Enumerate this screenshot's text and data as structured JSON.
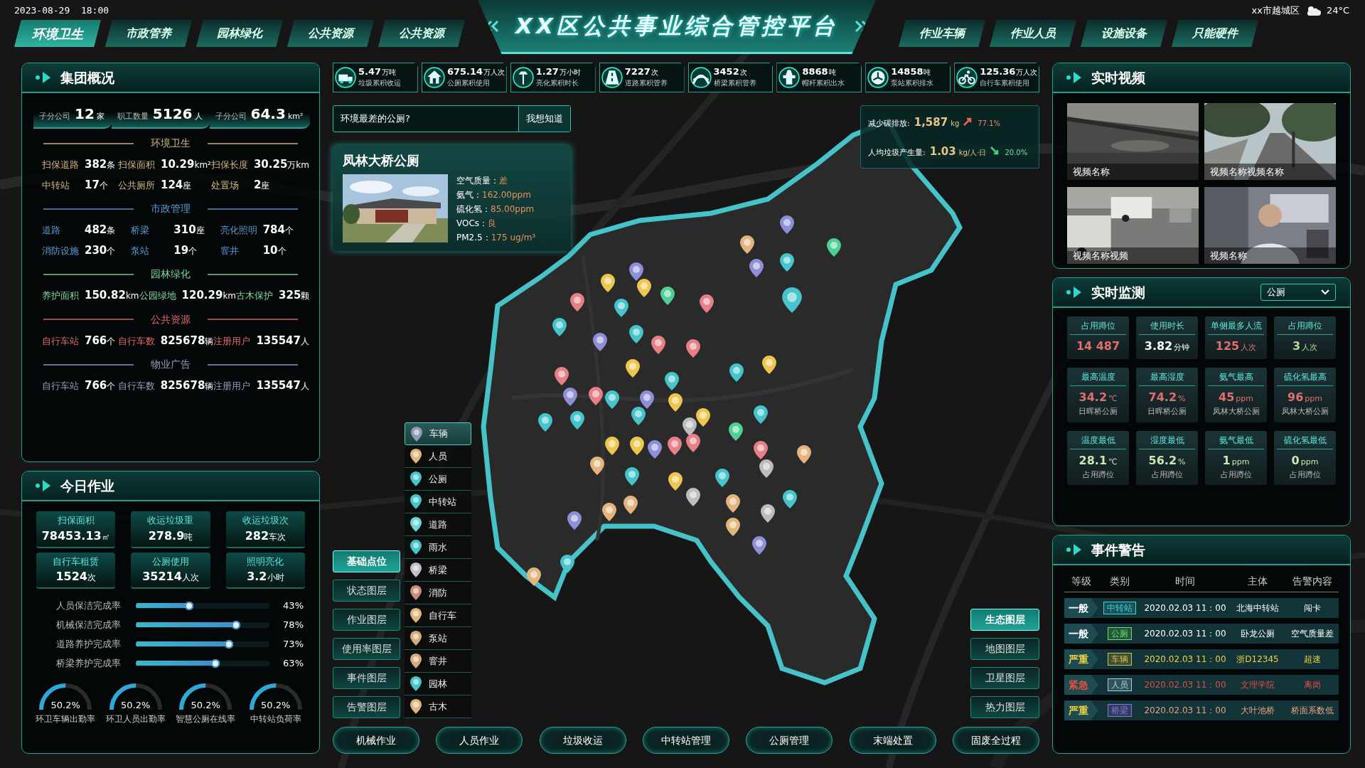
{
  "header": {
    "datetime": "2023-08-29  18:00",
    "title": "XX区公共事业综合管控平台",
    "location": "xx市越城区",
    "temperature": "24°C",
    "left_tabs": [
      {
        "label": "环境卫生",
        "selected": true
      },
      {
        "label": "市政管养",
        "selected": false
      },
      {
        "label": "园林绿化",
        "selected": false
      },
      {
        "label": "公共资源",
        "selected": false
      },
      {
        "label": "公共资源",
        "selected": false
      }
    ],
    "right_tabs": [
      {
        "label": "作业车辆",
        "selected": false
      },
      {
        "label": "作业人员",
        "selected": false
      },
      {
        "label": "设施设备",
        "selected": false
      },
      {
        "label": "只能硬件",
        "selected": false
      }
    ]
  },
  "group_overview": {
    "title": "集团概况",
    "summary": [
      {
        "label": "子分公司",
        "value": "12",
        "unit": "家"
      },
      {
        "label": "职工数量",
        "value": "5126",
        "unit": "人"
      },
      {
        "label": "子分公司",
        "value": "64.3",
        "unit": "km²"
      }
    ],
    "sections": [
      {
        "title": "环境卫生",
        "color": "#d4b483",
        "items": [
          {
            "label": "扫保道路",
            "value": "382",
            "unit": "条"
          },
          {
            "label": "扫保面积",
            "value": "10.29",
            "unit": "km²"
          },
          {
            "label": "扫保长度",
            "value": "30.25",
            "unit": "万km"
          },
          {
            "label": "中转站",
            "value": "17",
            "unit": "个"
          },
          {
            "label": "公共厕所",
            "value": "124",
            "unit": "座"
          },
          {
            "label": "处置场",
            "value": "2",
            "unit": "座"
          }
        ]
      },
      {
        "title": "市政管理",
        "color": "#5b9bd5",
        "items": [
          {
            "label": "道路",
            "value": "482",
            "unit": "条"
          },
          {
            "label": "桥梁",
            "value": "310",
            "unit": "座"
          },
          {
            "label": "亮化照明",
            "value": "784",
            "unit": "个"
          },
          {
            "label": "消防设施",
            "value": "230",
            "unit": "个"
          },
          {
            "label": "泵站",
            "value": "19",
            "unit": "个"
          },
          {
            "label": "窨井",
            "value": "10",
            "unit": "个"
          }
        ]
      },
      {
        "title": "园林绿化",
        "color": "#7ed6a0",
        "items": [
          {
            "label": "养护面积",
            "value": "150.82",
            "unit": "km"
          },
          {
            "label": "公园绿地",
            "value": "120.29",
            "unit": "km"
          },
          {
            "label": "古木保护",
            "value": "325",
            "unit": "颗"
          }
        ]
      },
      {
        "title": "公共资源",
        "color": "#e46a6a",
        "items": [
          {
            "label": "自行车站",
            "value": "766",
            "unit": "个"
          },
          {
            "label": "自行车数",
            "value": "825678",
            "unit": "辆"
          },
          {
            "label": "注册用户",
            "value": "135547",
            "unit": "人"
          }
        ]
      },
      {
        "title": "物业广告",
        "color": "#9b9bc0",
        "items": [
          {
            "label": "自行车站",
            "value": "766",
            "unit": "个"
          },
          {
            "label": "自行车数",
            "value": "825678",
            "unit": "辆"
          },
          {
            "label": "注册用户",
            "value": "135547",
            "unit": "人"
          }
        ]
      }
    ]
  },
  "today_work": {
    "title": "今日作业",
    "tiles": [
      {
        "label": "扫保面积",
        "value": "78453.13",
        "unit": "㎡"
      },
      {
        "label": "收运垃圾重",
        "value": "278.9",
        "unit": "吨"
      },
      {
        "label": "收运垃圾次",
        "value": "282",
        "unit": "车次"
      },
      {
        "label": "自行车租赁",
        "value": "1524",
        "unit": "次"
      },
      {
        "label": "公厕使用",
        "value": "35214",
        "unit": "人次"
      },
      {
        "label": "照明亮化",
        "value": "3.2",
        "unit": "小时"
      }
    ],
    "progress": [
      {
        "label": "人员保洁完成率",
        "level": 0.43,
        "reading": "43%"
      },
      {
        "label": "机械保洁完成率",
        "level": 0.78,
        "reading": "78%"
      },
      {
        "label": "道路养护完成率",
        "level": 0.73,
        "reading": "73%"
      },
      {
        "label": "桥梁养护完成率",
        "level": 0.63,
        "reading": "63%"
      }
    ],
    "gauges": [
      {
        "level": 0.502,
        "reading": "50.2%",
        "label": "环卫车辆出勤率"
      },
      {
        "level": 0.502,
        "reading": "50.2%",
        "label": "环卫人员出勤率"
      },
      {
        "level": 0.502,
        "reading": "50.2%",
        "label": "智慧公厕在线率"
      },
      {
        "level": 0.502,
        "reading": "50.2%",
        "label": "中转站负荷率"
      }
    ]
  },
  "stats": [
    {
      "kind": "truck",
      "value": "5.47",
      "unit": "万吨",
      "label": "垃圾累积收运"
    },
    {
      "kind": "toilet",
      "value": "675.14",
      "unit": "万人次",
      "label": "公厕累积使用"
    },
    {
      "kind": "lamp",
      "value": "1.27",
      "unit": "万小时",
      "label": "亮化累积时长"
    },
    {
      "kind": "road",
      "value": "7227",
      "unit": "次",
      "label": "道路累积管养"
    },
    {
      "kind": "bridge",
      "value": "3452",
      "unit": "次",
      "label": "桥梁累积管养"
    },
    {
      "kind": "hydrant",
      "value": "8868",
      "unit": "吨",
      "label": "帽杆累积出水"
    },
    {
      "kind": "pump",
      "value": "14858",
      "unit": "吨",
      "label": "泵站累积排水"
    },
    {
      "kind": "bike",
      "value": "125.36",
      "unit": "万人次",
      "label": "自行车累积使用"
    }
  ],
  "query": {
    "value": "环境最差的公厕?",
    "button": "我想知道"
  },
  "facility_card": {
    "title": "凤林大桥公厕",
    "readings": [
      {
        "label": "空气质量：",
        "value": "差"
      },
      {
        "label": "氨气：",
        "value": "162.00ppm"
      },
      {
        "label": "硫化氢：",
        "value": "85.00ppm"
      },
      {
        "label": "VOCs：",
        "value": "良"
      },
      {
        "label": "PM2.5：",
        "value": "175 ug/m³"
      }
    ]
  },
  "carbon": [
    {
      "label": "减少碳排放:",
      "value": "1,587",
      "unit": "kg",
      "kind": "up",
      "change": "77.1%"
    },
    {
      "label": "人均垃圾产生量:",
      "value": "1.03",
      "unit": "kg/人·日",
      "kind": "down",
      "change": "20.0%"
    }
  ],
  "layer_list": [
    {
      "label": "车辆",
      "color": "#8f9ab8",
      "selected": true
    },
    {
      "label": "人员",
      "color": "#e3b57c",
      "selected": false
    },
    {
      "label": "公厕",
      "color": "#45c4cc",
      "selected": false
    },
    {
      "label": "中转站",
      "color": "#45c4cc",
      "selected": false
    },
    {
      "label": "道路",
      "color": "#6dd4d8",
      "selected": false
    },
    {
      "label": "雨水",
      "color": "#45c4cc",
      "selected": false
    },
    {
      "label": "桥梁",
      "color": "#c0c0c8",
      "selected": false
    },
    {
      "label": "消防",
      "color": "#c98a7a",
      "selected": false
    },
    {
      "label": "自行车",
      "color": "#e3b57c",
      "selected": false
    },
    {
      "label": "泵站",
      "color": "#d8a878",
      "selected": false
    },
    {
      "label": "窨井",
      "color": "#d8a878",
      "selected": false
    },
    {
      "label": "园林",
      "color": "#45c4cc",
      "selected": false
    },
    {
      "label": "古木",
      "color": "#e3b57c",
      "selected": false
    }
  ],
  "layer_modes": [
    {
      "label": "基础点位",
      "selected": true
    },
    {
      "label": "状态图层",
      "selected": false
    },
    {
      "label": "作业图层",
      "selected": false
    },
    {
      "label": "使用率图层",
      "selected": false
    },
    {
      "label": "事件图层",
      "selected": false
    },
    {
      "label": "告警图层",
      "selected": false
    }
  ],
  "base_maps": [
    {
      "label": "生态图层",
      "selected": true
    },
    {
      "label": "地图图层",
      "selected": false
    },
    {
      "label": "卫星图层",
      "selected": false
    },
    {
      "label": "热力图层",
      "selected": false
    }
  ],
  "bottom_buttons": [
    "机械作业",
    "人员作业",
    "垃圾收运",
    "中转站管理",
    "公厕管理",
    "末端处置",
    "固废全过程"
  ],
  "map_pins": [
    {
      "color": "#8e8fd8"
    },
    {
      "color": "#e3b57c"
    },
    {
      "color": "#4fcf95"
    },
    {
      "color": "#8e8fd8"
    },
    {
      "color": "#45c4cc"
    },
    {
      "color": "#8e8fd8"
    },
    {
      "color": "#efc64d"
    },
    {
      "color": "#efc64d"
    },
    {
      "color": "#4fcf95"
    },
    {
      "color": "#e77f86"
    },
    {
      "color": "#45c4cc"
    },
    {
      "color": "#e77f86"
    },
    {
      "color": "#45c4cc"
    },
    {
      "color": "#45c4cc"
    },
    {
      "color": "#8e8fd8"
    },
    {
      "color": "#45c4cc"
    },
    {
      "color": "#e77f86"
    },
    {
      "color": "#e77f86"
    },
    {
      "color": "#efc64d"
    },
    {
      "color": "#45c4cc"
    },
    {
      "color": "#efc64d"
    },
    {
      "color": "#e77f86"
    },
    {
      "color": "#e77f86"
    },
    {
      "color": "#45c4cc"
    },
    {
      "color": "#8e8fd8"
    },
    {
      "color": "#45c4cc"
    },
    {
      "color": "#8e8fd8"
    },
    {
      "color": "#efc64d"
    },
    {
      "color": "#45c4cc"
    },
    {
      "color": "#efc64d"
    },
    {
      "color": "#45c4cc"
    },
    {
      "color": "#45c4cc"
    },
    {
      "color": "#bdbdbd"
    },
    {
      "color": "#45c4cc"
    },
    {
      "color": "#efc64d"
    },
    {
      "color": "#efc64d"
    },
    {
      "color": "#8e8fd8"
    },
    {
      "color": "#e77f86"
    },
    {
      "color": "#e77f86"
    },
    {
      "color": "#4fcf95"
    },
    {
      "color": "#e77f86"
    },
    {
      "color": "#e3b57c"
    },
    {
      "color": "#bdbdbd"
    },
    {
      "color": "#e3b57c"
    },
    {
      "color": "#45c4cc"
    },
    {
      "color": "#efc64d"
    },
    {
      "color": "#45c4cc"
    },
    {
      "color": "#45c4cc"
    },
    {
      "color": "#bdbdbd"
    },
    {
      "color": "#e3b57c"
    },
    {
      "color": "#e3b57c"
    },
    {
      "color": "#e3b57c"
    },
    {
      "color": "#bdbdbd"
    },
    {
      "color": "#8e8fd8"
    },
    {
      "color": "#e3b57c"
    },
    {
      "color": "#8e8fd8"
    },
    {
      "color": "#45c4cc"
    },
    {
      "color": "#e3b57c"
    }
  ],
  "videos": {
    "title": "实时视频",
    "items": [
      {
        "caption": "视频名称"
      },
      {
        "caption": "视频名称视频名称"
      },
      {
        "caption": "视频名称视频"
      },
      {
        "caption": "视频名称"
      }
    ]
  },
  "monitor": {
    "title": "实时监测",
    "filter": "公厕",
    "tiles": [
      {
        "label": "占用蹲位",
        "value": "14 487",
        "color": "#e07070"
      },
      {
        "label": "使用时长",
        "value": "3.82",
        "unit": "分钟",
        "color": "#ffffff"
      },
      {
        "label": "单侧最多人流",
        "value": "125",
        "unit": "人次",
        "color": "#e07070"
      },
      {
        "label": "占用蹲位",
        "value": "3",
        "unit": "人次",
        "color": "#b0dca0"
      },
      {
        "label": "最高温度",
        "value": "34.2",
        "unit": "℃",
        "note": "日晖桥公厕",
        "color": "#e07070"
      },
      {
        "label": "最高湿度",
        "value": "74.2",
        "unit": "%",
        "note": "日晖桥公厕",
        "color": "#e07070"
      },
      {
        "label": "氨气最高",
        "value": "45",
        "unit": "ppm",
        "note": "凤林大桥公厕",
        "color": "#e07070"
      },
      {
        "label": "硫化氢最高",
        "value": "96",
        "unit": "ppm",
        "note": "凤林大桥公厕",
        "color": "#e07070"
      },
      {
        "label": "温度最低",
        "value": "28.1",
        "unit": "℃",
        "note": "占用蹲位",
        "color": "#c8e8b0"
      },
      {
        "label": "湿度最低",
        "value": "56.2",
        "unit": "%",
        "note": "占用蹲位",
        "color": "#c8e8b0"
      },
      {
        "label": "氨气最低",
        "value": "1",
        "unit": "ppm",
        "note": "占用蹲位",
        "color": "#c8e8b0"
      },
      {
        "label": "硫化氢最低",
        "value": "0",
        "unit": "ppm",
        "note": "占用蹲位",
        "color": "#c8e8b0"
      }
    ]
  },
  "alerts": {
    "title": "事件警告",
    "columns": [
      "等级",
      "类别",
      "时间",
      "主体",
      "告警内容"
    ],
    "rows": [
      {
        "level": {
          "text": "一般",
          "color": "#ffffff"
        },
        "category": {
          "text": "中转站",
          "color": "#3fd0d8"
        },
        "time": "2020.02.03 11：00",
        "subject": "北海中转站",
        "content": "闯卡",
        "color": "#ffffff"
      },
      {
        "level": {
          "text": "一般",
          "color": "#ffffff"
        },
        "category": {
          "text": "公厕",
          "color": "#6ee060"
        },
        "time": "2020.02.03 11：00",
        "subject": "卧龙公厕",
        "content": "空气质量差",
        "color": "#ffffff"
      },
      {
        "level": {
          "text": "严重",
          "color": "#f0d040"
        },
        "category": {
          "text": "车辆",
          "color": "#d8c040"
        },
        "time": "2020.02.03 11：00",
        "subject": "浙D12345",
        "content": "超速",
        "color": "#f0d040"
      },
      {
        "level": {
          "text": "紧急",
          "color": "#e05040"
        },
        "category": {
          "text": "人员",
          "color": "#a8d0e0"
        },
        "time": "2020.02.03 11：00",
        "subject": "文理学院",
        "content": "离岗",
        "color": "#e05040"
      },
      {
        "level": {
          "text": "严重",
          "color": "#f0d040"
        },
        "category": {
          "text": "桥梁",
          "color": "#9070e0"
        },
        "time": "2020.02.03 11：00",
        "subject": "大叶池桥",
        "content": "桥面系数低",
        "color": "#e8a080"
      }
    ]
  }
}
